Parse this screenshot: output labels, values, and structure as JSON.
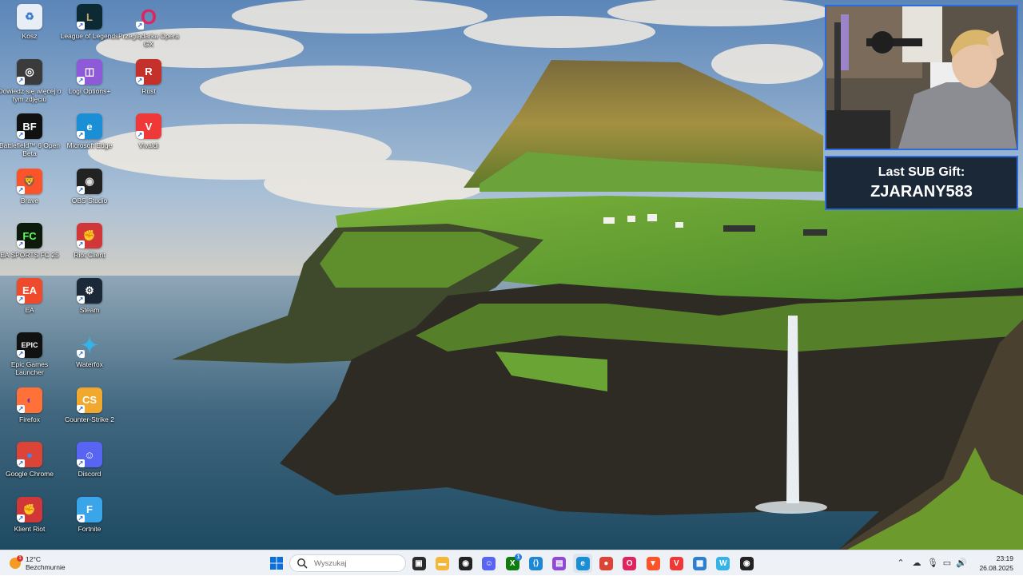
{
  "desktop": {
    "icons": [
      {
        "id": "kosz",
        "label": "Kosz",
        "icon": "recycle-bin-icon",
        "bg": "#e8eef6",
        "glyph": "♻",
        "fg": "#3a78c9"
      },
      {
        "id": "league",
        "label": "League of Legends",
        "icon": "league-of-legends-icon",
        "bg": "#0b2a33",
        "glyph": "L",
        "fg": "#c8aa6e"
      },
      {
        "id": "opera",
        "label": "Przeglądarka Opera GX",
        "icon": "opera-gx-icon",
        "bg": "transparent",
        "glyph": "O",
        "fg": "#e0245e"
      },
      {
        "id": "dowiedz",
        "label": "Dowiedz się więcej o tym zdjęciu",
        "icon": "camera-info-icon",
        "bg": "#3b3b3b",
        "glyph": "◎",
        "fg": "#fff"
      },
      {
        "id": "logi",
        "label": "Logi Options+",
        "icon": "logi-options-icon",
        "bg": "#8f5ad8",
        "glyph": "◫",
        "fg": "#fff"
      },
      {
        "id": "rust",
        "label": "Rust",
        "icon": "rust-icon",
        "bg": "#c4312b",
        "glyph": "R",
        "fg": "#fff"
      },
      {
        "id": "battlefield",
        "label": "Battlefield™ 6 Open Beta",
        "icon": "battlefield-icon",
        "bg": "#111",
        "glyph": "BF",
        "fg": "#fff"
      },
      {
        "id": "edge",
        "label": "Microsoft Edge",
        "icon": "edge-icon",
        "bg": "#1b8fd6",
        "glyph": "e",
        "fg": "#fff"
      },
      {
        "id": "vivaldi",
        "label": "Vivaldi",
        "icon": "vivaldi-icon",
        "bg": "#ef3939",
        "glyph": "V",
        "fg": "#fff"
      },
      {
        "id": "brave",
        "label": "Brave",
        "icon": "brave-icon",
        "bg": "#fb542b",
        "glyph": "🦁",
        "fg": "#fff"
      },
      {
        "id": "obs",
        "label": "OBS Studio",
        "icon": "obs-icon",
        "bg": "#222",
        "glyph": "◉",
        "fg": "#ddd"
      },
      {
        "id": "fc25",
        "label": "EA SPORTS FC 25",
        "icon": "ea-fc25-icon",
        "bg": "#0c1a0c",
        "glyph": "FC",
        "fg": "#5dff5a"
      },
      {
        "id": "riotclient",
        "label": "Riot Client",
        "icon": "riot-client-icon",
        "bg": "#d13639",
        "glyph": "✊",
        "fg": "#fff"
      },
      {
        "id": "ea",
        "label": "EA",
        "icon": "ea-icon",
        "bg": "#ef4a2b",
        "glyph": "EA",
        "fg": "#fff"
      },
      {
        "id": "steam",
        "label": "Steam",
        "icon": "steam-icon",
        "bg": "#1b2838",
        "glyph": "⚙",
        "fg": "#fff"
      },
      {
        "id": "epic",
        "label": "Epic Games Launcher",
        "icon": "epic-games-icon",
        "bg": "#111",
        "glyph": "EPIC",
        "fg": "#fff"
      },
      {
        "id": "waterfox",
        "label": "Waterfox",
        "icon": "waterfox-icon",
        "bg": "transparent",
        "glyph": "✦",
        "fg": "#35b3e8"
      },
      {
        "id": "firefox",
        "label": "Firefox",
        "icon": "firefox-icon",
        "bg": "#ff7139",
        "glyph": "◐",
        "fg": "#7a2ea8"
      },
      {
        "id": "cs2",
        "label": "Counter-Strike 2",
        "icon": "counter-strike-icon",
        "bg": "#f0a82e",
        "glyph": "CS",
        "fg": "#fff"
      },
      {
        "id": "chrome",
        "label": "Google Chrome",
        "icon": "chrome-icon",
        "bg": "#db4437",
        "glyph": "●",
        "fg": "#4285f4"
      },
      {
        "id": "discord",
        "label": "Discord",
        "icon": "discord-icon",
        "bg": "#5865f2",
        "glyph": "☺",
        "fg": "#fff"
      },
      {
        "id": "klientriot",
        "label": "Klient Riot",
        "icon": "riot-client-icon",
        "bg": "#d13639",
        "glyph": "✊",
        "fg": "#fff"
      },
      {
        "id": "fortnite",
        "label": "Fortnite",
        "icon": "fortnite-icon",
        "bg": "#3aa5e8",
        "glyph": "F",
        "fg": "#fff"
      }
    ]
  },
  "overlay": {
    "gift_title": "Last SUB Gift:",
    "gift_name": "ZJARANY583"
  },
  "taskbar": {
    "weather_temp": "12°C",
    "weather_desc": "Bezchmurnie",
    "weather_badge": "1",
    "search_placeholder": "Wyszukaj",
    "apps": [
      {
        "name": "task-view-button",
        "icon": "task-view-icon",
        "bg": "#2b2b2b",
        "glyph": "▣"
      },
      {
        "name": "file-explorer-button",
        "icon": "folder-icon",
        "bg": "#f4b73a",
        "glyph": "▬"
      },
      {
        "name": "obs-button",
        "icon": "obs-icon",
        "bg": "#222",
        "glyph": "◉"
      },
      {
        "name": "discord-button",
        "icon": "discord-icon",
        "bg": "#5865f2",
        "glyph": "☺"
      },
      {
        "name": "xbox-button",
        "icon": "xbox-icon",
        "bg": "#107c10",
        "glyph": "X"
      },
      {
        "name": "vscode-button",
        "icon": "vscode-icon",
        "bg": "#1e88d4",
        "glyph": "⟨⟩"
      },
      {
        "name": "app-purple-button",
        "icon": "purple-app-icon",
        "bg": "#8f4bd8",
        "glyph": "▤"
      },
      {
        "name": "edge-button",
        "icon": "edge-icon",
        "bg": "#1b8fd6",
        "glyph": "e"
      },
      {
        "name": "chrome-button",
        "icon": "chrome-icon",
        "bg": "#db4437",
        "glyph": "●"
      },
      {
        "name": "opera-button",
        "icon": "opera-gx-icon",
        "bg": "#e0245e",
        "glyph": "O"
      },
      {
        "name": "brave-button",
        "icon": "brave-icon",
        "bg": "#fb542b",
        "glyph": "▼"
      },
      {
        "name": "vivaldi-button",
        "icon": "vivaldi-icon",
        "bg": "#ef3939",
        "glyph": "V"
      },
      {
        "name": "photos-button",
        "icon": "photos-icon",
        "bg": "#2d7fd0",
        "glyph": "▦"
      },
      {
        "name": "waterfox-button",
        "icon": "waterfox-icon",
        "bg": "#35b3e8",
        "glyph": "W"
      },
      {
        "name": "obs-record-button",
        "icon": "obs-record-icon",
        "bg": "#222",
        "glyph": "◉"
      }
    ],
    "xbox_badge": "1",
    "time": "23:19",
    "date": "26.08.2025"
  }
}
